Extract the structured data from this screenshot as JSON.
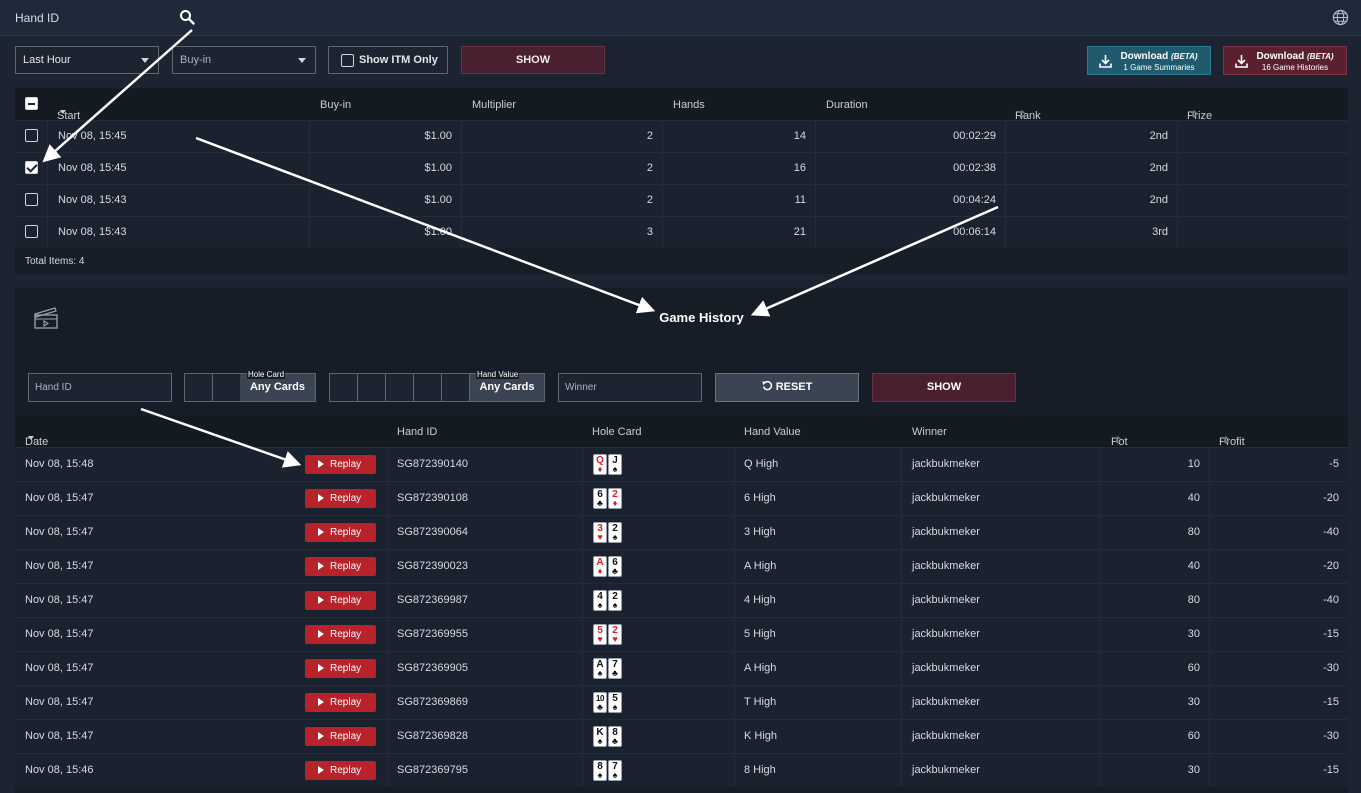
{
  "topbar": {
    "hand_id_label": "Hand ID"
  },
  "filters": {
    "period": "Last Hour",
    "buyin_placeholder": "Buy-in",
    "itm_label": "Show ITM Only",
    "show_label": "SHOW",
    "download1": {
      "title": "Download",
      "beta": "(BETA)",
      "sub": "1 Game Summaries"
    },
    "download2": {
      "title": "Download",
      "beta": "(BETA)",
      "sub": "16 Game Histories"
    }
  },
  "tournaments": {
    "headers": [
      "Start Time",
      "Buy-in",
      "Multiplier",
      "Hands",
      "Duration",
      "Rank",
      "Prize"
    ],
    "rows": [
      {
        "checked": false,
        "start": "Nov 08, 15:45",
        "buyin": "$1.00",
        "mult": "2",
        "hands": "14",
        "duration": "00:02:29",
        "rank": "2nd",
        "prize": ""
      },
      {
        "checked": true,
        "start": "Nov 08, 15:45",
        "buyin": "$1.00",
        "mult": "2",
        "hands": "16",
        "duration": "00:02:38",
        "rank": "2nd",
        "prize": ""
      },
      {
        "checked": false,
        "start": "Nov 08, 15:43",
        "buyin": "$1.00",
        "mult": "2",
        "hands": "11",
        "duration": "00:04:24",
        "rank": "2nd",
        "prize": ""
      },
      {
        "checked": false,
        "start": "Nov 08, 15:43",
        "buyin": "$1.00",
        "mult": "3",
        "hands": "21",
        "duration": "00:06:14",
        "rank": "3rd",
        "prize": ""
      }
    ],
    "total": "Total Items: 4"
  },
  "game_history": {
    "title": "Game History",
    "hand_id_placeholder": "Hand ID",
    "hole_card_label": "Hole Card",
    "hole_card_value": "Any Cards",
    "hand_value_label": "Hand Value",
    "hand_value_value": "Any Cards",
    "winner_placeholder": "Winner",
    "reset_label": "RESET",
    "show_label": "SHOW",
    "headers": [
      "Date",
      "Hand ID",
      "Hole Card",
      "Hand Value",
      "Winner",
      "Pot",
      "Profit"
    ],
    "replay_label": "Replay",
    "rows": [
      {
        "date": "Nov 08, 15:48",
        "hand_id": "SG872390140",
        "cards": [
          [
            "Q",
            "♦",
            "red"
          ],
          [
            "J",
            "♠",
            "blk"
          ]
        ],
        "value": "Q High",
        "winner": "jackbukmeker",
        "pot": "10",
        "profit": "-5"
      },
      {
        "date": "Nov 08, 15:47",
        "hand_id": "SG872390108",
        "cards": [
          [
            "6",
            "♣",
            "blk"
          ],
          [
            "2",
            "♦",
            "red"
          ]
        ],
        "value": "6 High",
        "winner": "jackbukmeker",
        "pot": "40",
        "profit": "-20"
      },
      {
        "date": "Nov 08, 15:47",
        "hand_id": "SG872390064",
        "cards": [
          [
            "3",
            "♥",
            "red"
          ],
          [
            "2",
            "♠",
            "blk"
          ]
        ],
        "value": "3 High",
        "winner": "jackbukmeker",
        "pot": "80",
        "profit": "-40"
      },
      {
        "date": "Nov 08, 15:47",
        "hand_id": "SG872390023",
        "cards": [
          [
            "A",
            "♦",
            "red"
          ],
          [
            "6",
            "♣",
            "blk"
          ]
        ],
        "value": "A High",
        "winner": "jackbukmeker",
        "pot": "40",
        "profit": "-20"
      },
      {
        "date": "Nov 08, 15:47",
        "hand_id": "SG872369987",
        "cards": [
          [
            "4",
            "♠",
            "blk"
          ],
          [
            "2",
            "♠",
            "blk"
          ]
        ],
        "value": "4 High",
        "winner": "jackbukmeker",
        "pot": "80",
        "profit": "-40"
      },
      {
        "date": "Nov 08, 15:47",
        "hand_id": "SG872369955",
        "cards": [
          [
            "5",
            "♥",
            "red"
          ],
          [
            "2",
            "♥",
            "red"
          ]
        ],
        "value": "5 High",
        "winner": "jackbukmeker",
        "pot": "30",
        "profit": "-15"
      },
      {
        "date": "Nov 08, 15:47",
        "hand_id": "SG872369905",
        "cards": [
          [
            "A",
            "♠",
            "blk"
          ],
          [
            "7",
            "♣",
            "blk"
          ]
        ],
        "value": "A High",
        "winner": "jackbukmeker",
        "pot": "60",
        "profit": "-30"
      },
      {
        "date": "Nov 08, 15:47",
        "hand_id": "SG872369869",
        "cards": [
          [
            "10",
            "♣",
            "blk"
          ],
          [
            "5",
            "♠",
            "blk"
          ]
        ],
        "value": "T High",
        "winner": "jackbukmeker",
        "pot": "30",
        "profit": "-15"
      },
      {
        "date": "Nov 08, 15:47",
        "hand_id": "SG872369828",
        "cards": [
          [
            "K",
            "♠",
            "blk"
          ],
          [
            "8",
            "♣",
            "blk"
          ]
        ],
        "value": "K High",
        "winner": "jackbukmeker",
        "pot": "60",
        "profit": "-30"
      },
      {
        "date": "Nov 08, 15:46",
        "hand_id": "SG872369795",
        "cards": [
          [
            "8",
            "♠",
            "blk"
          ],
          [
            "7",
            "♠",
            "blk"
          ]
        ],
        "value": "8 High",
        "winner": "jackbukmeker",
        "pot": "30",
        "profit": "-15"
      }
    ]
  },
  "colors": {
    "accent_red": "#b8232b",
    "teal": "#1f5a6e",
    "maroon": "#4a2030"
  }
}
